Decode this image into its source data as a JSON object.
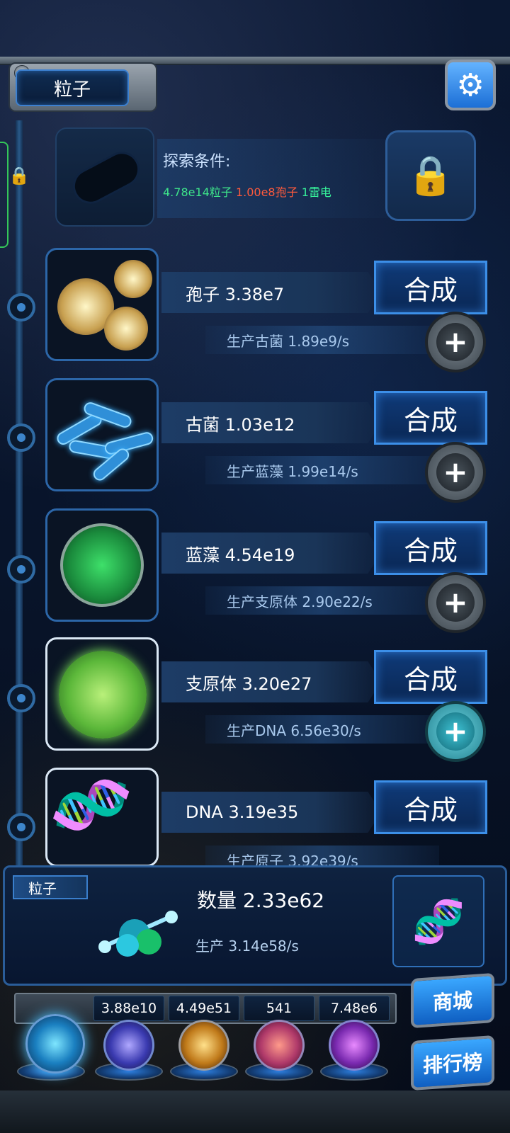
{
  "header": {
    "title": "粒子"
  },
  "explore": {
    "title": "探索条件:",
    "cond_particles": "4.78e14粒子",
    "cond_spores": "1.00e8孢子",
    "cond_thunder": "1雷电"
  },
  "units": [
    {
      "name": "孢子 3.38e7",
      "rate": "生产古菌 1.89e9/s",
      "button": "合成"
    },
    {
      "name": "古菌 1.03e12",
      "rate": "生产蓝藻 1.99e14/s",
      "button": "合成"
    },
    {
      "name": "蓝藻 4.54e19",
      "rate": "生产支原体 2.90e22/s",
      "button": "合成"
    },
    {
      "name": "支原体 3.20e27",
      "rate": "生产DNA 6.56e30/s",
      "button": "合成"
    },
    {
      "name": "DNA 3.19e35",
      "rate": "生产原子 3.92e39/s",
      "button": "合成"
    }
  ],
  "bottom": {
    "tag": "粒子",
    "count": "数量 2.33e62",
    "rate": "生产 3.14e58/s"
  },
  "resources": [
    "3.88e10",
    "4.49e51",
    "541",
    "7.48e6"
  ],
  "side_buttons": {
    "shop": "商城",
    "rank": "排行榜"
  },
  "colors": {
    "accent": "#3c8fe8",
    "cond_green": "#3ee58a",
    "cond_red": "#ff5a3c"
  }
}
